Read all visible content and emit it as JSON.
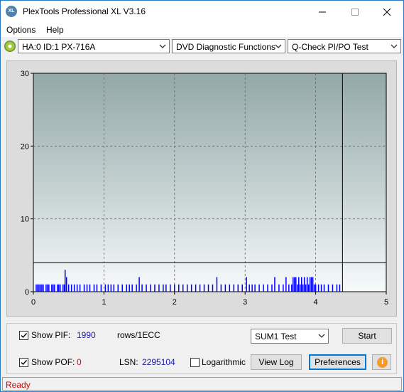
{
  "window": {
    "title": "PlexTools Professional XL V3.16",
    "app_icon_text": "XL"
  },
  "menu": {
    "options": "Options",
    "help": "Help"
  },
  "toolbar": {
    "drive": "HA:0 ID:1  PX-716A",
    "function": "DVD Diagnostic Functions",
    "test": "Q-Check PI/PO Test"
  },
  "chart_data": {
    "type": "bar",
    "x_ticks": [
      "0",
      "1",
      "2",
      "3",
      "4",
      "5"
    ],
    "y_ticks": [
      "0",
      "10",
      "20",
      "30"
    ],
    "xlim": [
      0,
      5
    ],
    "ylim": [
      0,
      30
    ],
    "grid": true,
    "end_marker_x": 4.38,
    "threshold_y": 4,
    "bar_color": "#0000ff",
    "bars": [
      {
        "x": 0.04,
        "y": 1
      },
      {
        "x": 0.06,
        "y": 1
      },
      {
        "x": 0.08,
        "y": 1
      },
      {
        "x": 0.1,
        "y": 1
      },
      {
        "x": 0.12,
        "y": 1
      },
      {
        "x": 0.14,
        "y": 1
      },
      {
        "x": 0.18,
        "y": 1
      },
      {
        "x": 0.2,
        "y": 1
      },
      {
        "x": 0.22,
        "y": 1
      },
      {
        "x": 0.26,
        "y": 1
      },
      {
        "x": 0.28,
        "y": 1
      },
      {
        "x": 0.3,
        "y": 1
      },
      {
        "x": 0.34,
        "y": 1
      },
      {
        "x": 0.36,
        "y": 1
      },
      {
        "x": 0.38,
        "y": 1
      },
      {
        "x": 0.42,
        "y": 1
      },
      {
        "x": 0.44,
        "y": 1
      },
      {
        "x": 0.45,
        "y": 3
      },
      {
        "x": 0.47,
        "y": 2
      },
      {
        "x": 0.5,
        "y": 1
      },
      {
        "x": 0.54,
        "y": 1
      },
      {
        "x": 0.58,
        "y": 1
      },
      {
        "x": 0.62,
        "y": 1
      },
      {
        "x": 0.66,
        "y": 1
      },
      {
        "x": 0.72,
        "y": 1
      },
      {
        "x": 0.76,
        "y": 1
      },
      {
        "x": 0.8,
        "y": 1
      },
      {
        "x": 0.86,
        "y": 1
      },
      {
        "x": 0.9,
        "y": 1
      },
      {
        "x": 0.96,
        "y": 1
      },
      {
        "x": 1.02,
        "y": 1
      },
      {
        "x": 1.06,
        "y": 1
      },
      {
        "x": 1.1,
        "y": 1
      },
      {
        "x": 1.14,
        "y": 1
      },
      {
        "x": 1.2,
        "y": 1
      },
      {
        "x": 1.26,
        "y": 1
      },
      {
        "x": 1.32,
        "y": 1
      },
      {
        "x": 1.36,
        "y": 1
      },
      {
        "x": 1.4,
        "y": 1
      },
      {
        "x": 1.46,
        "y": 1
      },
      {
        "x": 1.5,
        "y": 2
      },
      {
        "x": 1.54,
        "y": 1
      },
      {
        "x": 1.6,
        "y": 1
      },
      {
        "x": 1.66,
        "y": 1
      },
      {
        "x": 1.72,
        "y": 1
      },
      {
        "x": 1.78,
        "y": 1
      },
      {
        "x": 1.84,
        "y": 1
      },
      {
        "x": 1.88,
        "y": 1
      },
      {
        "x": 1.94,
        "y": 1
      },
      {
        "x": 2.0,
        "y": 1
      },
      {
        "x": 2.06,
        "y": 1
      },
      {
        "x": 2.12,
        "y": 1
      },
      {
        "x": 2.18,
        "y": 1
      },
      {
        "x": 2.24,
        "y": 1
      },
      {
        "x": 2.3,
        "y": 1
      },
      {
        "x": 2.36,
        "y": 1
      },
      {
        "x": 2.42,
        "y": 1
      },
      {
        "x": 2.48,
        "y": 1
      },
      {
        "x": 2.54,
        "y": 1
      },
      {
        "x": 2.6,
        "y": 2
      },
      {
        "x": 2.66,
        "y": 1
      },
      {
        "x": 2.72,
        "y": 1
      },
      {
        "x": 2.78,
        "y": 1
      },
      {
        "x": 2.84,
        "y": 1
      },
      {
        "x": 2.9,
        "y": 1
      },
      {
        "x": 2.96,
        "y": 1
      },
      {
        "x": 3.02,
        "y": 2
      },
      {
        "x": 3.06,
        "y": 1
      },
      {
        "x": 3.1,
        "y": 1
      },
      {
        "x": 3.14,
        "y": 1
      },
      {
        "x": 3.2,
        "y": 1
      },
      {
        "x": 3.26,
        "y": 1
      },
      {
        "x": 3.32,
        "y": 1
      },
      {
        "x": 3.38,
        "y": 1
      },
      {
        "x": 3.42,
        "y": 2
      },
      {
        "x": 3.48,
        "y": 1
      },
      {
        "x": 3.54,
        "y": 1
      },
      {
        "x": 3.58,
        "y": 2
      },
      {
        "x": 3.62,
        "y": 1
      },
      {
        "x": 3.66,
        "y": 1
      },
      {
        "x": 3.68,
        "y": 2
      },
      {
        "x": 3.7,
        "y": 2
      },
      {
        "x": 3.72,
        "y": 2
      },
      {
        "x": 3.74,
        "y": 1
      },
      {
        "x": 3.76,
        "y": 2
      },
      {
        "x": 3.78,
        "y": 1
      },
      {
        "x": 3.8,
        "y": 2
      },
      {
        "x": 3.82,
        "y": 1
      },
      {
        "x": 3.84,
        "y": 2
      },
      {
        "x": 3.86,
        "y": 1
      },
      {
        "x": 3.88,
        "y": 2
      },
      {
        "x": 3.9,
        "y": 1
      },
      {
        "x": 3.92,
        "y": 2
      },
      {
        "x": 3.94,
        "y": 2
      },
      {
        "x": 3.96,
        "y": 2
      },
      {
        "x": 3.98,
        "y": 1
      },
      {
        "x": 4.0,
        "y": 1
      },
      {
        "x": 4.04,
        "y": 1
      },
      {
        "x": 4.08,
        "y": 1
      },
      {
        "x": 4.12,
        "y": 1
      },
      {
        "x": 4.18,
        "y": 1
      },
      {
        "x": 4.24,
        "y": 1
      },
      {
        "x": 4.3,
        "y": 1
      },
      {
        "x": 4.34,
        "y": 1
      }
    ]
  },
  "controls": {
    "show_pif_label": "Show PIF:",
    "pif_value": "1990",
    "pif_unit": "rows/1ECC",
    "show_pof_label": "Show POF:",
    "pof_value": "0",
    "lsn_label": "LSN:",
    "lsn_value": "2295104",
    "logarithmic_label": "Logarithmic",
    "sum_select": "SUM1 Test",
    "start": "Start",
    "view_log": "View Log",
    "preferences": "Preferences"
  },
  "status": {
    "text": "Ready"
  }
}
